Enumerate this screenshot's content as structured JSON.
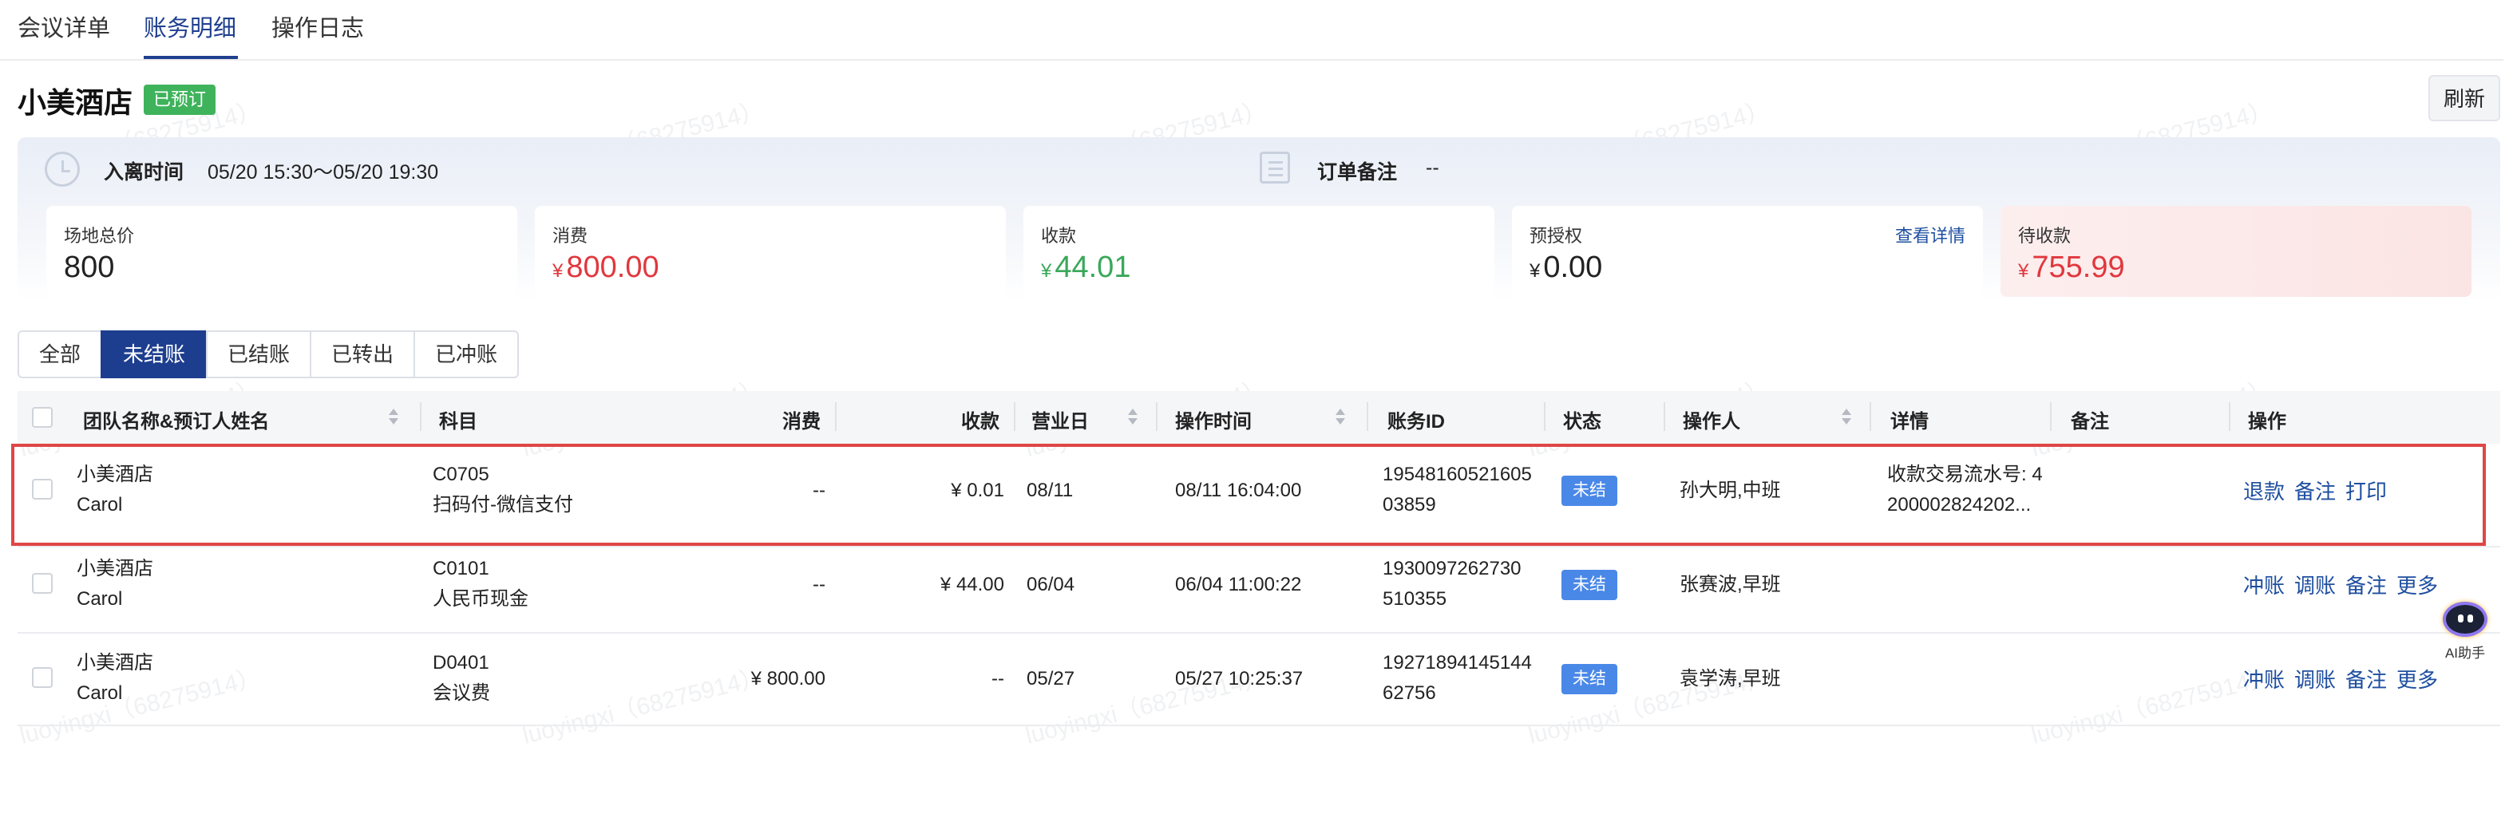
{
  "tabs": [
    {
      "label": "会议详单"
    },
    {
      "label": "账务明细"
    },
    {
      "label": "操作日志"
    }
  ],
  "header": {
    "title": "小美酒店",
    "badge": "已预订",
    "refresh": "刷新"
  },
  "summary": {
    "time_label": "入离时间",
    "time_value": "05/20 15:30～05/20 19:30",
    "note_label": "订单备注",
    "note_value": "--",
    "cards": [
      {
        "label": "场地总价",
        "currency": "",
        "value": "800"
      },
      {
        "label": "消费",
        "currency": "¥",
        "value": "800.00"
      },
      {
        "label": "收款",
        "currency": "¥",
        "value": "44.01"
      },
      {
        "label": "预授权",
        "currency": "¥",
        "value": "0.00",
        "link": "查看详情"
      },
      {
        "label": "待收款",
        "currency": "¥",
        "value": "755.99"
      }
    ]
  },
  "filters": [
    "全部",
    "未结账",
    "已结账",
    "已转出",
    "已冲账"
  ],
  "active_filter": "未结账",
  "table": {
    "columns": [
      "团队名称&预订人姓名",
      "科目",
      "消费",
      "收款",
      "营业日",
      "操作时间",
      "账务ID",
      "状态",
      "操作人",
      "详情",
      "备注",
      "操作"
    ],
    "rows": [
      {
        "team": "小美酒店",
        "booker": "Carol",
        "code": "C0705",
        "subject": "扫码付-微信支付",
        "consume": "--",
        "receive": "¥ 0.01",
        "business_day": "08/11",
        "op_time": "08/11 16:04:00",
        "id_line1": "19548160521605",
        "id_line2": "03859",
        "status": "未结",
        "operator": "孙大明,中班",
        "detail_line1": "收款交易流水号: 4",
        "detail_line2": "200002824202...",
        "remark": "",
        "actions": [
          "退款",
          "备注",
          "打印"
        ]
      },
      {
        "team": "小美酒店",
        "booker": "Carol",
        "code": "C0101",
        "subject": "人民币现金",
        "consume": "--",
        "receive": "¥ 44.00",
        "business_day": "06/04",
        "op_time": "06/04 11:00:22",
        "id_line1": "1930097262730",
        "id_line2": "510355",
        "status": "未结",
        "operator": "张赛波,早班",
        "detail_line1": "",
        "detail_line2": "",
        "remark": "",
        "actions": [
          "冲账",
          "调账",
          "备注",
          "更多"
        ]
      },
      {
        "team": "小美酒店",
        "booker": "Carol",
        "code": "D0401",
        "subject": "会议费",
        "consume": "¥ 800.00",
        "receive": "--",
        "business_day": "05/27",
        "op_time": "05/27 10:25:37",
        "id_line1": "19271894145144",
        "id_line2": "62756",
        "status": "未结",
        "operator": "袁学涛,早班",
        "detail_line1": "",
        "detail_line2": "",
        "remark": "",
        "actions": [
          "冲账",
          "调账",
          "备注",
          "更多"
        ]
      }
    ]
  },
  "ai_helper": {
    "label": "AI助手"
  },
  "watermark": "luoyingxi（68275914）",
  "colors": {
    "primary": "#1d3e8f",
    "red": "#e0383e",
    "green": "#3aa85a",
    "badge_green": "#3fb35b",
    "status_blue": "#4a88e8"
  }
}
